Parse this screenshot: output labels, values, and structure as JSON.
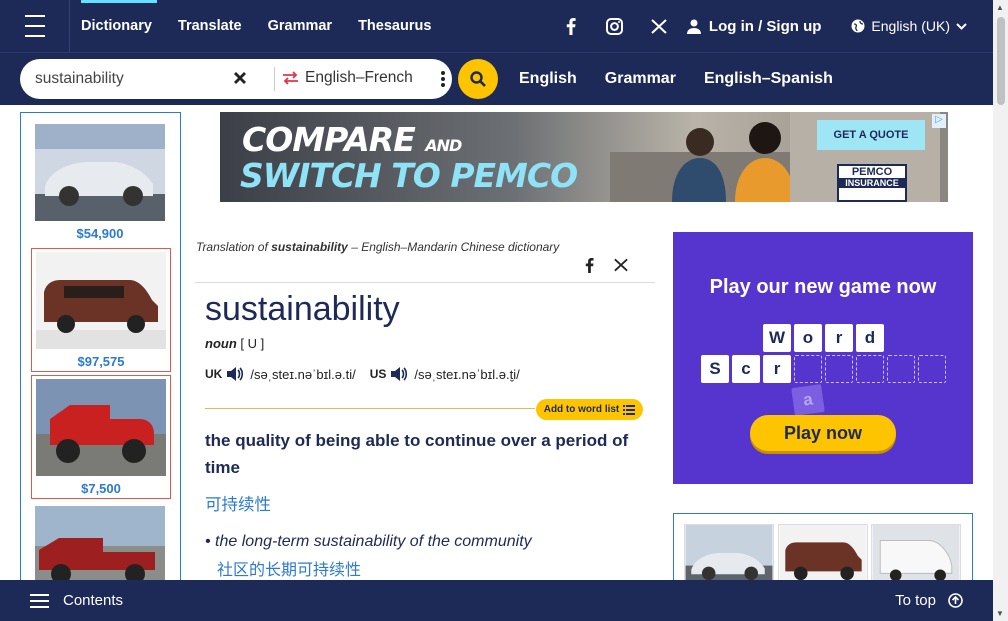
{
  "nav": {
    "menu_icon": "hamburger-icon",
    "items": [
      {
        "label": "Dictionary",
        "active": true
      },
      {
        "label": "Translate",
        "active": false
      },
      {
        "label": "Grammar",
        "active": false
      },
      {
        "label": "Thesaurus",
        "active": false
      }
    ],
    "social": [
      "facebook-icon",
      "instagram-icon",
      "x-icon"
    ],
    "login_label": "Log in / Sign up",
    "language_label": "English (UK)"
  },
  "search": {
    "value": "sustainability",
    "dictionary_pair": "English–French",
    "quick_links": [
      "English",
      "Grammar",
      "English–Spanish"
    ]
  },
  "left_ads": {
    "prices": [
      "$54,900",
      "$97,575",
      "$7,500"
    ]
  },
  "banner": {
    "line1": "COMPARE",
    "line1_small": "AND",
    "line2": "SWITCH TO PEMCO",
    "cta": "GET A QUOTE",
    "brand": "PEMCO",
    "brand_sub": "INSURANCE"
  },
  "entry": {
    "translation_of_prefix": "Translation of",
    "translation_of_word": "sustainability",
    "translation_of_suffix": "– English–Mandarin Chinese dictionary",
    "headword": "sustainability",
    "pos": "noun",
    "grammar": "[ U ]",
    "pron_uk_label": "UK",
    "pron_uk": "/səˌsteɪ.nəˈbɪl.ə.ti/",
    "pron_us_label": "US",
    "pron_us": "/səˌsteɪ.nəˈbɪl.ə.t̬i/",
    "add_to_list": "Add to word list",
    "definition": "the quality of being able to continue over a period of time",
    "definition_translation": "可持续性",
    "example": "the long-term sustainability of the community",
    "example_translation": "社区的长期可持续性"
  },
  "game_ad": {
    "title": "Play our new game now",
    "row1": [
      "W",
      "o",
      "r",
      "d"
    ],
    "row2": [
      "S",
      "c",
      "r"
    ],
    "floating_tile": "a",
    "play_label": "Play now"
  },
  "bottom": {
    "contents_label": "Contents",
    "to_top_label": "To top"
  }
}
